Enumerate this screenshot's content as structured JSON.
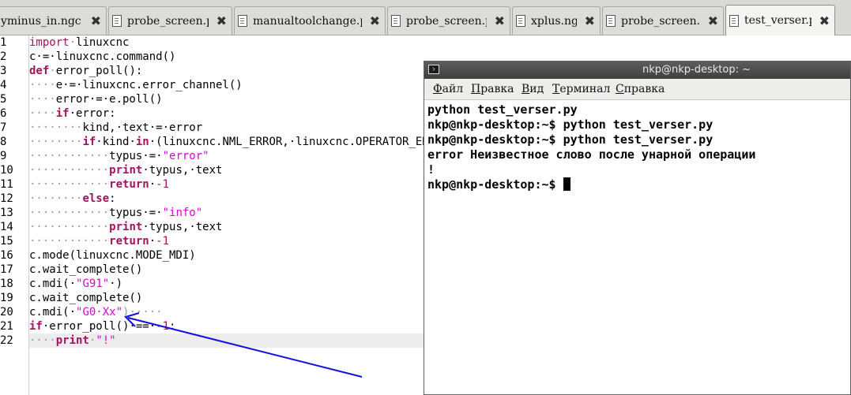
{
  "tabs": [
    {
      "label": "yminus_in.ngc",
      "close": "✖"
    },
    {
      "label": "probe_screen.py",
      "close": "✖"
    },
    {
      "label": "manualtoolchange.pref",
      "close": "✖"
    },
    {
      "label": "probe_screen.py",
      "close": "✖"
    },
    {
      "label": "xplus.ngc",
      "close": "✖"
    },
    {
      "label": "probe_screen.py",
      "close": "✖"
    },
    {
      "label": "test_verser.py",
      "close": "✖"
    }
  ],
  "line_numbers": [
    "1",
    "2",
    "3",
    "4",
    "5",
    "6",
    "7",
    "8",
    "9",
    "10",
    "11",
    "12",
    "13",
    "14",
    "15",
    "16",
    "17",
    "18",
    "19",
    "20",
    "21",
    "22"
  ],
  "code": {
    "l1": {
      "a": "import",
      "b": "·",
      "c": "linuxcnc"
    },
    "l2": {
      "a": "c·=·linuxcnc.command()"
    },
    "l3": {
      "a": "def",
      "b": "·",
      "c": "error_poll():"
    },
    "l4": {
      "ws": "····",
      "a": "e·=·linuxcnc.error_channel()"
    },
    "l5": {
      "ws": "····",
      "a": "error·=·e.poll()"
    },
    "l6": {
      "ws": "····",
      "kw": "if",
      "a": "·error:"
    },
    "l7": {
      "ws": "········",
      "a": "kind,·text·=·error"
    },
    "l8": {
      "ws": "········",
      "kw": "if",
      "a": "·kind·",
      "kw2": "in",
      "b": "·(linuxcnc.NML_ERROR,·linuxcnc.OPERATOR_ERROR):"
    },
    "l9": {
      "ws": "············",
      "a": "typus·=·",
      "s": "\"error\""
    },
    "l10": {
      "ws": "············",
      "kw": "print",
      "a": "·typus,·text"
    },
    "l11": {
      "ws": "············",
      "kw": "return",
      "a": "·",
      "n": "-1"
    },
    "l12": {
      "ws": "········",
      "kw": "else",
      "a": ":"
    },
    "l13": {
      "ws": "············",
      "a": "typus·=·",
      "s": "\"info\""
    },
    "l14": {
      "ws": "············",
      "kw": "print",
      "a": "·typus,·text"
    },
    "l15": {
      "ws": "············",
      "kw": "return",
      "a": "·",
      "n": "-1"
    },
    "l16": {
      "a": "c.mode(linuxcnc.MODE_MDI)"
    },
    "l17": {
      "a": "c.wait_complete()"
    },
    "l18": {
      "a": "c.mdi(·",
      "s": "\"G91\"",
      "b": "·)"
    },
    "l19": {
      "a": "c.wait_complete()"
    },
    "l20": {
      "a": "c.mdi(·",
      "s": "\"G0·Xx\"",
      "b": ")·····"
    },
    "l21": {
      "kw": "if",
      "a": "·error_poll()·==·",
      "n": "-1",
      "b": ":"
    },
    "l22": {
      "ws": "····",
      "kw": "print",
      "a": "·",
      "s": "\"!\""
    }
  },
  "terminal": {
    "title": "nkp@nkp-desktop: ~",
    "menu": [
      {
        "u": "Ф",
        "rest": "айл"
      },
      {
        "u": "П",
        "rest": "равка"
      },
      {
        "u": "В",
        "rest": "ид"
      },
      {
        "u": "Т",
        "rest": "ерминал"
      },
      {
        "u": "С",
        "rest": "правка"
      }
    ],
    "lines": [
      "python test_verser.py",
      "nkp@nkp-desktop:~$ python test_verser.py",
      "nkp@nkp-desktop:~$ python test_verser.py",
      "error Неизвестное слово после унарной операции",
      "!",
      "nkp@nkp-desktop:~$ "
    ]
  },
  "colors": {
    "keyword": "#a5125e",
    "string": "#d900d9",
    "arrow": "#1010e0"
  }
}
